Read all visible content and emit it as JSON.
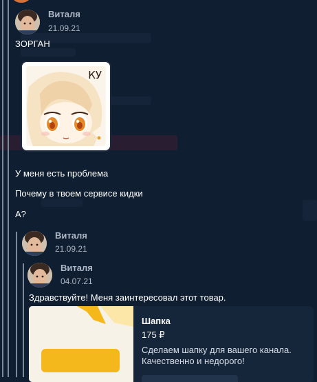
{
  "message": {
    "author": "Виталя",
    "date": "21.09.21",
    "lines": [
      "ЗОРГАН",
      "У меня есть проблема",
      "Почему в твоем сервисе кидки",
      "А?"
    ],
    "sticker": {
      "label": "КУ"
    }
  },
  "reply_level_1": {
    "author": "Виталя",
    "date": "21.09.21"
  },
  "reply_level_2": {
    "author": "Виталя",
    "date": "04.07.21",
    "text": "Здравствуйте! Меня заинтересовал этот товар.",
    "product": {
      "title": "Шапка",
      "price": "175 ₽",
      "description_lines": [
        "Сделаем шапку для вашего канала.",
        "Качественно и недорого!"
      ]
    }
  },
  "colors": {
    "background": "#0f1e31",
    "meta_text": "#aeb8c6",
    "thread_line": "#7d8a9c",
    "card": "#15253a",
    "accent": "#f2b317"
  }
}
